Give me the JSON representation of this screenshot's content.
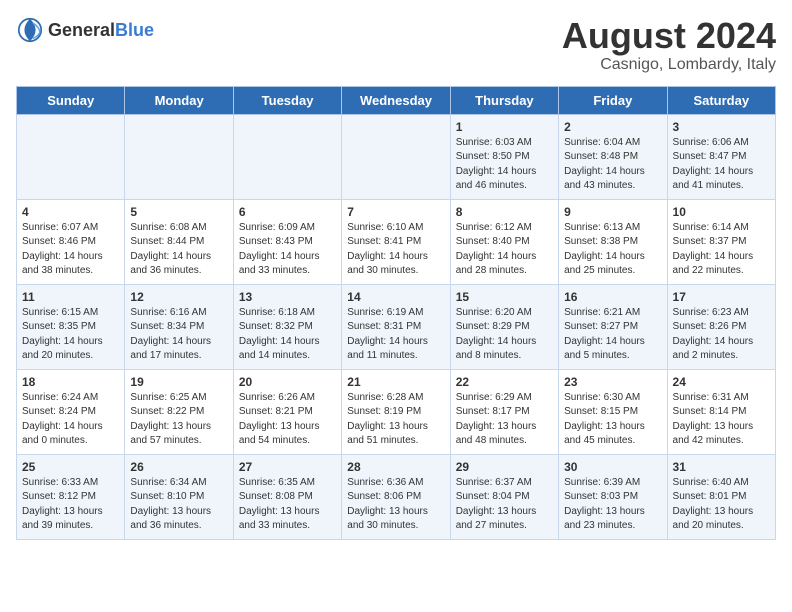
{
  "header": {
    "logo_general": "General",
    "logo_blue": "Blue",
    "title": "August 2024",
    "subtitle": "Casnigo, Lombardy, Italy"
  },
  "weekdays": [
    "Sunday",
    "Monday",
    "Tuesday",
    "Wednesday",
    "Thursday",
    "Friday",
    "Saturday"
  ],
  "weeks": [
    [
      {
        "day": "",
        "content": ""
      },
      {
        "day": "",
        "content": ""
      },
      {
        "day": "",
        "content": ""
      },
      {
        "day": "",
        "content": ""
      },
      {
        "day": "1",
        "content": "Sunrise: 6:03 AM\nSunset: 8:50 PM\nDaylight: 14 hours\nand 46 minutes."
      },
      {
        "day": "2",
        "content": "Sunrise: 6:04 AM\nSunset: 8:48 PM\nDaylight: 14 hours\nand 43 minutes."
      },
      {
        "day": "3",
        "content": "Sunrise: 6:06 AM\nSunset: 8:47 PM\nDaylight: 14 hours\nand 41 minutes."
      }
    ],
    [
      {
        "day": "4",
        "content": "Sunrise: 6:07 AM\nSunset: 8:46 PM\nDaylight: 14 hours\nand 38 minutes."
      },
      {
        "day": "5",
        "content": "Sunrise: 6:08 AM\nSunset: 8:44 PM\nDaylight: 14 hours\nand 36 minutes."
      },
      {
        "day": "6",
        "content": "Sunrise: 6:09 AM\nSunset: 8:43 PM\nDaylight: 14 hours\nand 33 minutes."
      },
      {
        "day": "7",
        "content": "Sunrise: 6:10 AM\nSunset: 8:41 PM\nDaylight: 14 hours\nand 30 minutes."
      },
      {
        "day": "8",
        "content": "Sunrise: 6:12 AM\nSunset: 8:40 PM\nDaylight: 14 hours\nand 28 minutes."
      },
      {
        "day": "9",
        "content": "Sunrise: 6:13 AM\nSunset: 8:38 PM\nDaylight: 14 hours\nand 25 minutes."
      },
      {
        "day": "10",
        "content": "Sunrise: 6:14 AM\nSunset: 8:37 PM\nDaylight: 14 hours\nand 22 minutes."
      }
    ],
    [
      {
        "day": "11",
        "content": "Sunrise: 6:15 AM\nSunset: 8:35 PM\nDaylight: 14 hours\nand 20 minutes."
      },
      {
        "day": "12",
        "content": "Sunrise: 6:16 AM\nSunset: 8:34 PM\nDaylight: 14 hours\nand 17 minutes."
      },
      {
        "day": "13",
        "content": "Sunrise: 6:18 AM\nSunset: 8:32 PM\nDaylight: 14 hours\nand 14 minutes."
      },
      {
        "day": "14",
        "content": "Sunrise: 6:19 AM\nSunset: 8:31 PM\nDaylight: 14 hours\nand 11 minutes."
      },
      {
        "day": "15",
        "content": "Sunrise: 6:20 AM\nSunset: 8:29 PM\nDaylight: 14 hours\nand 8 minutes."
      },
      {
        "day": "16",
        "content": "Sunrise: 6:21 AM\nSunset: 8:27 PM\nDaylight: 14 hours\nand 5 minutes."
      },
      {
        "day": "17",
        "content": "Sunrise: 6:23 AM\nSunset: 8:26 PM\nDaylight: 14 hours\nand 2 minutes."
      }
    ],
    [
      {
        "day": "18",
        "content": "Sunrise: 6:24 AM\nSunset: 8:24 PM\nDaylight: 14 hours\nand 0 minutes."
      },
      {
        "day": "19",
        "content": "Sunrise: 6:25 AM\nSunset: 8:22 PM\nDaylight: 13 hours\nand 57 minutes."
      },
      {
        "day": "20",
        "content": "Sunrise: 6:26 AM\nSunset: 8:21 PM\nDaylight: 13 hours\nand 54 minutes."
      },
      {
        "day": "21",
        "content": "Sunrise: 6:28 AM\nSunset: 8:19 PM\nDaylight: 13 hours\nand 51 minutes."
      },
      {
        "day": "22",
        "content": "Sunrise: 6:29 AM\nSunset: 8:17 PM\nDaylight: 13 hours\nand 48 minutes."
      },
      {
        "day": "23",
        "content": "Sunrise: 6:30 AM\nSunset: 8:15 PM\nDaylight: 13 hours\nand 45 minutes."
      },
      {
        "day": "24",
        "content": "Sunrise: 6:31 AM\nSunset: 8:14 PM\nDaylight: 13 hours\nand 42 minutes."
      }
    ],
    [
      {
        "day": "25",
        "content": "Sunrise: 6:33 AM\nSunset: 8:12 PM\nDaylight: 13 hours\nand 39 minutes."
      },
      {
        "day": "26",
        "content": "Sunrise: 6:34 AM\nSunset: 8:10 PM\nDaylight: 13 hours\nand 36 minutes."
      },
      {
        "day": "27",
        "content": "Sunrise: 6:35 AM\nSunset: 8:08 PM\nDaylight: 13 hours\nand 33 minutes."
      },
      {
        "day": "28",
        "content": "Sunrise: 6:36 AM\nSunset: 8:06 PM\nDaylight: 13 hours\nand 30 minutes."
      },
      {
        "day": "29",
        "content": "Sunrise: 6:37 AM\nSunset: 8:04 PM\nDaylight: 13 hours\nand 27 minutes."
      },
      {
        "day": "30",
        "content": "Sunrise: 6:39 AM\nSunset: 8:03 PM\nDaylight: 13 hours\nand 23 minutes."
      },
      {
        "day": "31",
        "content": "Sunrise: 6:40 AM\nSunset: 8:01 PM\nDaylight: 13 hours\nand 20 minutes."
      }
    ]
  ]
}
